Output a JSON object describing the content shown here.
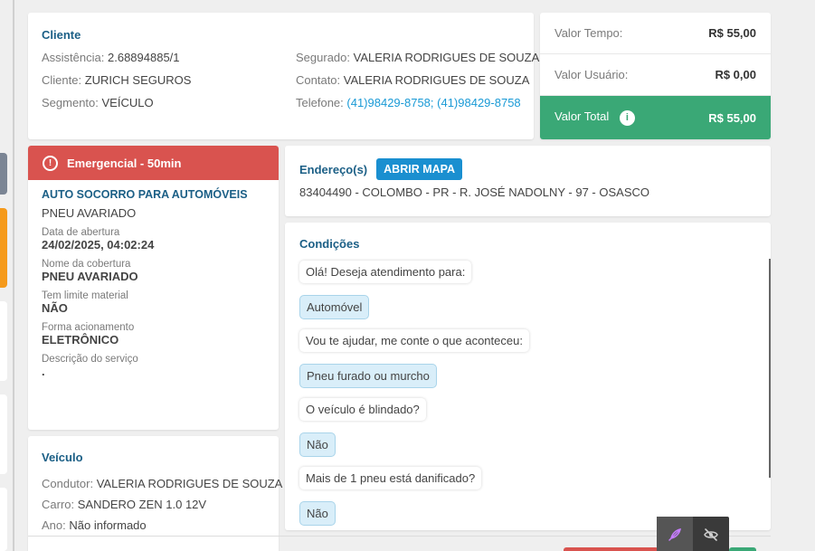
{
  "cliente": {
    "title": "Cliente",
    "assistencia_label": "Assistência:",
    "assistencia": "2.68894885/1",
    "cliente_label": "Cliente:",
    "cliente": "ZURICH SEGUROS",
    "segmento_label": "Segmento:",
    "segmento": "VEÍCULO",
    "segurado_label": "Segurado:",
    "segurado": "VALERIA RODRIGUES DE SOUZA",
    "contato_label": "Contato:",
    "contato": "VALERIA RODRIGUES DE SOUZA",
    "telefone_label": "Telefone:",
    "telefone": "(41)98429-8758; (41)98429-8758"
  },
  "valores": {
    "tempo_label": "Valor Tempo:",
    "tempo": "R$ 55,00",
    "usuario_label": "Valor Usuário:",
    "usuario": "R$ 0,00",
    "total_label": "Valor Total",
    "total": "R$ 55,00",
    "info_glyph": "i"
  },
  "servico": {
    "badge": "Emergencial - 50min",
    "warn_glyph": "!",
    "nome": "AUTO SOCORRO PARA AUTOMÓVEIS",
    "problema": "PNEU AVARIADO",
    "fields": [
      {
        "label": "Data de abertura",
        "value": "24/02/2025, 04:02:24"
      },
      {
        "label": "Nome da cobertura",
        "value": "PNEU AVARIADO"
      },
      {
        "label": "Tem limite material",
        "value": "NÃO"
      },
      {
        "label": "Forma acionamento",
        "value": "ELETRÔNICO"
      },
      {
        "label": "Descrição do serviço",
        "value": "."
      }
    ]
  },
  "endereco": {
    "title": "Endereço(s)",
    "button": "ABRIR MAPA",
    "line": "83404490 - COLOMBO - PR - R. JOSÉ NADOLNY - 97 - OSASCO"
  },
  "condicoes": {
    "title": "Condições",
    "messages": [
      {
        "type": "q",
        "text": "Olá! Deseja atendimento para:"
      },
      {
        "type": "a",
        "text": "Automóvel"
      },
      {
        "type": "q",
        "text": "Vou te ajudar, me conte o que aconteceu:"
      },
      {
        "type": "a",
        "text": "Pneu furado ou murcho"
      },
      {
        "type": "q",
        "text": "O veículo é blindado?"
      },
      {
        "type": "a",
        "text": "Não"
      },
      {
        "type": "q",
        "text": "Mais de 1 pneu está danificado?"
      },
      {
        "type": "a",
        "text": "Não"
      }
    ]
  },
  "veiculo": {
    "title": "Veículo",
    "condutor_label": "Condutor:",
    "condutor": "VALERIA RODRIGUES DE SOUZA",
    "carro_label": "Carro:",
    "carro": "SANDERO ZEN 1.0 12V",
    "ano_label": "Ano:",
    "ano": "Não informado"
  },
  "colors": {
    "accent_blue": "#1b5f86",
    "link_blue": "#1a9ad6",
    "emergency_red": "#d9534f",
    "total_green": "#3aa876"
  },
  "icons": [
    "info-icon",
    "warning-icon",
    "feather-icon",
    "eye-off-icon"
  ]
}
